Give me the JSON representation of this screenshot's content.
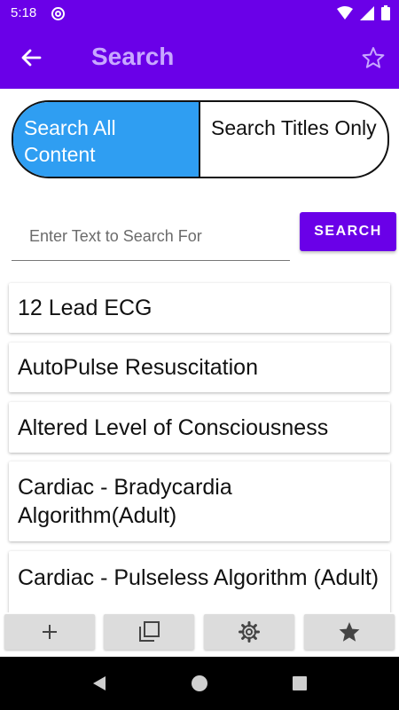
{
  "status_bar": {
    "time": "5:18",
    "icons": [
      "at-icon",
      "wifi-icon",
      "signal-icon",
      "battery-icon"
    ]
  },
  "app_bar": {
    "title": "Search",
    "back_icon": "arrow-left-icon",
    "favorite_icon": "star-outline-icon"
  },
  "search_mode": {
    "options": [
      {
        "label": "Search All Content",
        "selected": true
      },
      {
        "label": "Search Titles Only",
        "selected": false
      }
    ]
  },
  "search": {
    "placeholder": "Enter Text to Search For",
    "value": "",
    "button_label": "SEARCH"
  },
  "results": [
    {
      "title": "12 Lead ECG"
    },
    {
      "title": "AutoPulse Resuscitation"
    },
    {
      "title": "Altered Level of Consciousness"
    },
    {
      "title": "Cardiac - Bradycardia Algorithm(Adult)"
    },
    {
      "title": "Cardiac - Pulseless Algorithm (Adult)"
    }
  ],
  "toolbar": {
    "buttons": [
      "plus-icon",
      "copy-icon",
      "gear-icon",
      "star-icon"
    ]
  },
  "nav_bar": {
    "buttons": [
      "back-triangle-icon",
      "home-circle-icon",
      "recents-square-icon"
    ]
  },
  "colors": {
    "primary": "#6a00e8",
    "segment_selected": "#2f9ef2",
    "title_text": "#c8a8ff",
    "toolbar_button": "#dcdcdc"
  }
}
